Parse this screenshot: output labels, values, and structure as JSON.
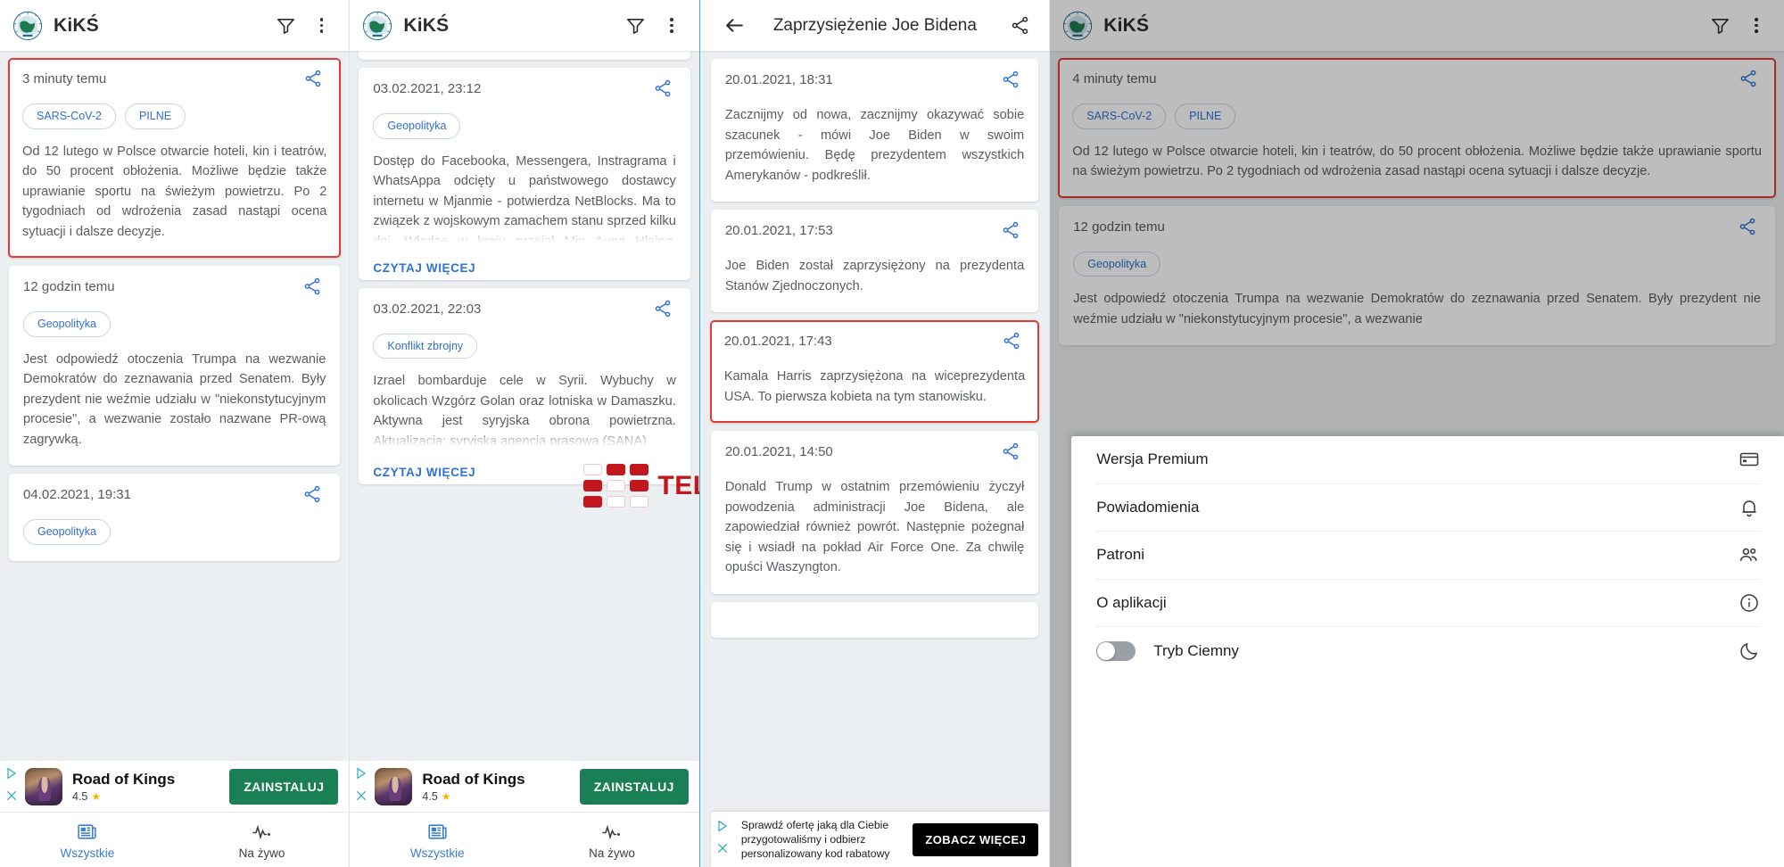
{
  "app": {
    "title": "KiKŚ",
    "logo_icon": "globe-logo",
    "filter_icon": "filter-icon",
    "overflow_icon": "kebab-menu-icon",
    "share_icon": "share-icon",
    "back_icon": "back-arrow-icon",
    "accent_blue": "#2f72d6",
    "highlight_red": "#e53935"
  },
  "bottom_nav": {
    "items": [
      {
        "label": "Wszystkie",
        "icon": "newspaper-icon",
        "active": true
      },
      {
        "label": "Na żywo",
        "icon": "pulse-icon",
        "active": false
      }
    ]
  },
  "ad_banner": {
    "title": "Road of Kings",
    "rating": "4.5",
    "star_icon": "star-icon",
    "cta": "ZAINSTALUJ",
    "choices_icon": "ad-choices-icon",
    "close_icon": "close-icon",
    "cta_color": "#1a7f55"
  },
  "text_ad": {
    "line1": "Sprawdź ofertę jaką dla Ciebie",
    "line2": "przygotowaliśmy i odbierz",
    "line3": "personalizowany kod rabatowy",
    "cta": "ZOBACZ WIĘCEJ",
    "choices_icon": "ad-choices-icon",
    "close_icon": "close-icon"
  },
  "watermark": {
    "text": "TELEPOLIS",
    "color": "#c2171c"
  },
  "panel1": {
    "cards": [
      {
        "time": "3 minuty temu",
        "highlighted": true,
        "chips": [
          "SARS-CoV-2",
          "PILNE"
        ],
        "body": "Od 12 lutego w Polsce otwarcie hoteli, kin i teatrów, do 50 procent obłożenia. Możliwe będzie także uprawianie sportu na świeżym powietrzu. Po 2 tygodniach od wdrożenia zasad nastąpi ocena sytuacji i dalsze decyzje."
      },
      {
        "time": "12 godzin temu",
        "highlighted": false,
        "chips": [
          "Geopolityka"
        ],
        "body": "Jest odpowiedź otoczenia Trumpa na wezwanie Demokratów do zeznawania przed Senatem. Były prezydent nie weźmie udziału w \"niekonstytucyjnym procesie\", a wezwanie zostało nazwane PR-ową zagrywką."
      },
      {
        "time": "04.02.2021, 19:31",
        "highlighted": false,
        "chips": [
          "Geopolityka"
        ],
        "body": ""
      }
    ]
  },
  "panel2": {
    "read_more_label": "CZYTAJ WIĘCEJ",
    "cards": [
      {
        "time": "03.02.2021, 23:12",
        "chips": [
          "Geopolityka"
        ],
        "body": "Dostęp do Facebooka, Messengera, Instragrama i WhatsAppa odcięty u państwowego dostawcy internetu w Mjanmie - potwierdza NetBlocks. Ma to związek z wojskowym zamachem stanu sprzed kilku dni. Władzę w kraju przejął Min Aung Hlaing, głównodowodzący sił zbrojnych.",
        "truncated": true
      },
      {
        "time": "03.02.2021, 22:03",
        "chips": [
          "Konflikt zbrojny"
        ],
        "body": "Izrael bombarduje cele w Syrii. Wybuchy w okolicach Wzgórz Golan oraz lotniska w Damaszku. Aktywna jest syryjska obrona powietrzna. Aktualizacja: syryjska agencja prasowa (SANA)",
        "truncated": true
      }
    ]
  },
  "panel3": {
    "title": "Zaprzysiężenie Joe Bidena",
    "cards": [
      {
        "time": "20.01.2021, 18:31",
        "highlighted": false,
        "body": "Zacznijmy od nowa, zacznijmy okazywać sobie szacunek - mówi Joe Biden w swoim przemówieniu. Będę prezydentem wszystkich Amerykanów - podkreślił."
      },
      {
        "time": "20.01.2021, 17:53",
        "highlighted": false,
        "body": "Joe Biden został zaprzysiężony na prezydenta Stanów Zjednoczonych."
      },
      {
        "time": "20.01.2021, 17:43",
        "highlighted": true,
        "body": "Kamala Harris zaprzysiężona na wiceprezydenta USA. To pierwsza kobieta na tym stanowisku."
      },
      {
        "time": "20.01.2021, 14:50",
        "highlighted": false,
        "body": "Donald Trump w ostatnim przemówieniu życzył powodzenia administracji Joe Bidena, ale zapowiedział również powrót. Następnie pożegnał się i wsiadł na pokład Air Force One. Za chwilę opuści Waszyngton."
      }
    ]
  },
  "panel4": {
    "cards": [
      {
        "time": "4 minuty temu",
        "highlighted": true,
        "chips": [
          "SARS-CoV-2",
          "PILNE"
        ],
        "body": "Od 12 lutego w Polsce otwarcie hoteli, kin i teatrów, do 50 procent obłożenia. Możliwe będzie także uprawianie sportu na świeżym powietrzu. Po 2 tygodniach od wdrożenia zasad nastąpi ocena sytuacji i dalsze decyzje."
      },
      {
        "time": "12 godzin temu",
        "highlighted": false,
        "chips": [
          "Geopolityka"
        ],
        "body": "Jest odpowiedź otoczenia Trumpa na wezwanie Demokratów do zeznawania przed Senatem. Były prezydent nie weźmie udziału w \"niekonstytucyjnym procesie\", a wezwanie"
      }
    ],
    "menu": {
      "items": [
        {
          "label": "Wersja Premium",
          "icon": "credit-card-icon"
        },
        {
          "label": "Powiadomienia",
          "icon": "bell-icon"
        },
        {
          "label": "Patroni",
          "icon": "people-icon"
        },
        {
          "label": "O aplikacji",
          "icon": "info-icon"
        }
      ],
      "toggle": {
        "label": "Tryb Ciemny",
        "icon": "moon-icon",
        "on": false
      }
    }
  }
}
